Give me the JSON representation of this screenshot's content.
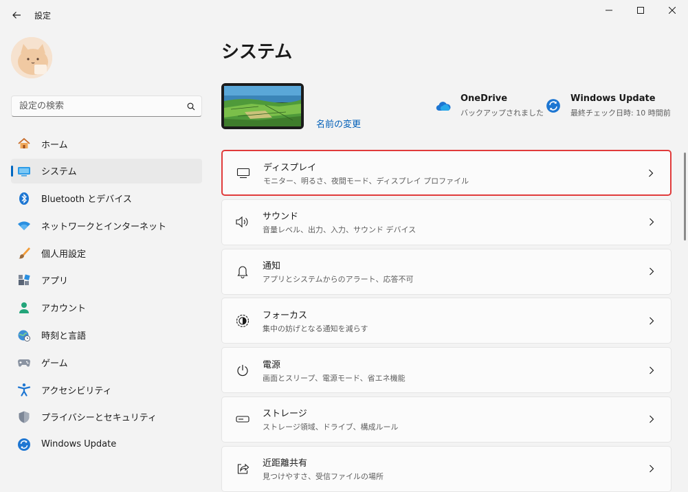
{
  "app": {
    "title": "設定"
  },
  "search": {
    "placeholder": "設定の検索"
  },
  "sidebar": {
    "items": [
      {
        "label": "ホーム",
        "icon": "home-icon",
        "selected": false
      },
      {
        "label": "システム",
        "icon": "system-icon",
        "selected": true
      },
      {
        "label": "Bluetooth とデバイス",
        "icon": "bluetooth-icon",
        "selected": false
      },
      {
        "label": "ネットワークとインターネット",
        "icon": "wifi-icon",
        "selected": false
      },
      {
        "label": "個人用設定",
        "icon": "brush-icon",
        "selected": false
      },
      {
        "label": "アプリ",
        "icon": "apps-icon",
        "selected": false
      },
      {
        "label": "アカウント",
        "icon": "account-icon",
        "selected": false
      },
      {
        "label": "時刻と言語",
        "icon": "globe-clock-icon",
        "selected": false
      },
      {
        "label": "ゲーム",
        "icon": "gamepad-icon",
        "selected": false
      },
      {
        "label": "アクセシビリティ",
        "icon": "accessibility-icon",
        "selected": false
      },
      {
        "label": "プライバシーとセキュリティ",
        "icon": "shield-icon",
        "selected": false
      },
      {
        "label": "Windows Update",
        "icon": "update-icon",
        "selected": false
      }
    ]
  },
  "main": {
    "title": "システム",
    "rename_link": "名前の変更",
    "onedrive": {
      "title": "OneDrive",
      "subtitle": "バックアップされました"
    },
    "windows_update": {
      "title": "Windows Update",
      "subtitle": "最終チェック日時: 10 時間前"
    },
    "cards": [
      {
        "title": "ディスプレイ",
        "subtitle": "モニター、明るさ、夜間モード、ディスプレイ プロファイル",
        "icon": "display-icon",
        "highlight": true
      },
      {
        "title": "サウンド",
        "subtitle": "音量レベル、出力、入力、サウンド デバイス",
        "icon": "speaker-icon",
        "highlight": false
      },
      {
        "title": "通知",
        "subtitle": "アプリとシステムからのアラート、応答不可",
        "icon": "bell-icon",
        "highlight": false
      },
      {
        "title": "フォーカス",
        "subtitle": "集中の妨げとなる通知を減らす",
        "icon": "focus-icon",
        "highlight": false
      },
      {
        "title": "電源",
        "subtitle": "画面とスリープ、電源モード、省エネ機能",
        "icon": "power-icon",
        "highlight": false
      },
      {
        "title": "ストレージ",
        "subtitle": "ストレージ領域、ドライブ、構成ルール",
        "icon": "storage-icon",
        "highlight": false
      },
      {
        "title": "近距離共有",
        "subtitle": "見つけやすさ、受信ファイルの場所",
        "icon": "share-icon",
        "highlight": false
      }
    ]
  },
  "colors": {
    "accent": "#0067c0",
    "link": "#005fb8",
    "highlight_border": "#e03a3a",
    "background": "#f3f3f3"
  }
}
